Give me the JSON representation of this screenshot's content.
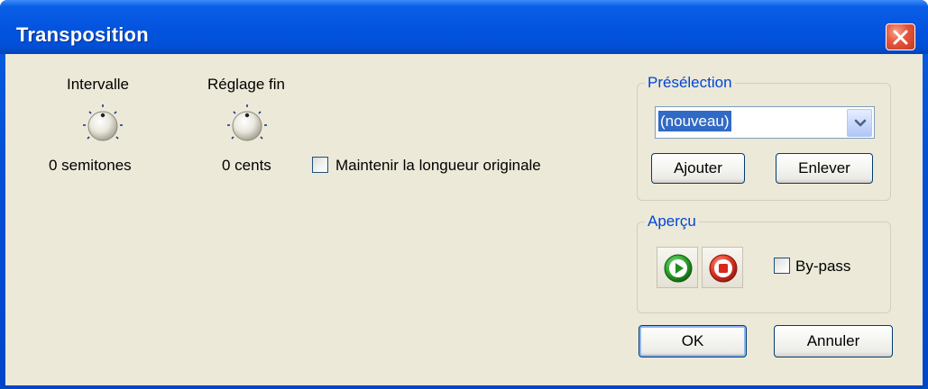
{
  "window": {
    "title": "Transposition",
    "close_icon": "close-icon"
  },
  "controls": {
    "interval": {
      "label": "Intervalle",
      "value": "0 semitones"
    },
    "fine_tune": {
      "label": "Réglage fin",
      "value": "0 cents"
    },
    "keep_length": {
      "label": "Maintenir la longueur originale",
      "checked": false
    }
  },
  "preset": {
    "group_label": "Présélection",
    "selected": "(nouveau)",
    "add_label": "Ajouter",
    "remove_label": "Enlever"
  },
  "preview": {
    "group_label": "Aperçu",
    "play_icon": "play-icon",
    "stop_icon": "stop-icon",
    "bypass_label": "By-pass",
    "bypass_checked": false
  },
  "footer": {
    "ok_label": "OK",
    "cancel_label": "Annuler"
  },
  "colors": {
    "titlebar": "#0454e0",
    "client": "#ece9d8",
    "group_title": "#0046d5",
    "selection": "#316ac5",
    "close": "#e4543a",
    "play": "#2ea52e",
    "stop": "#e03a2a"
  }
}
